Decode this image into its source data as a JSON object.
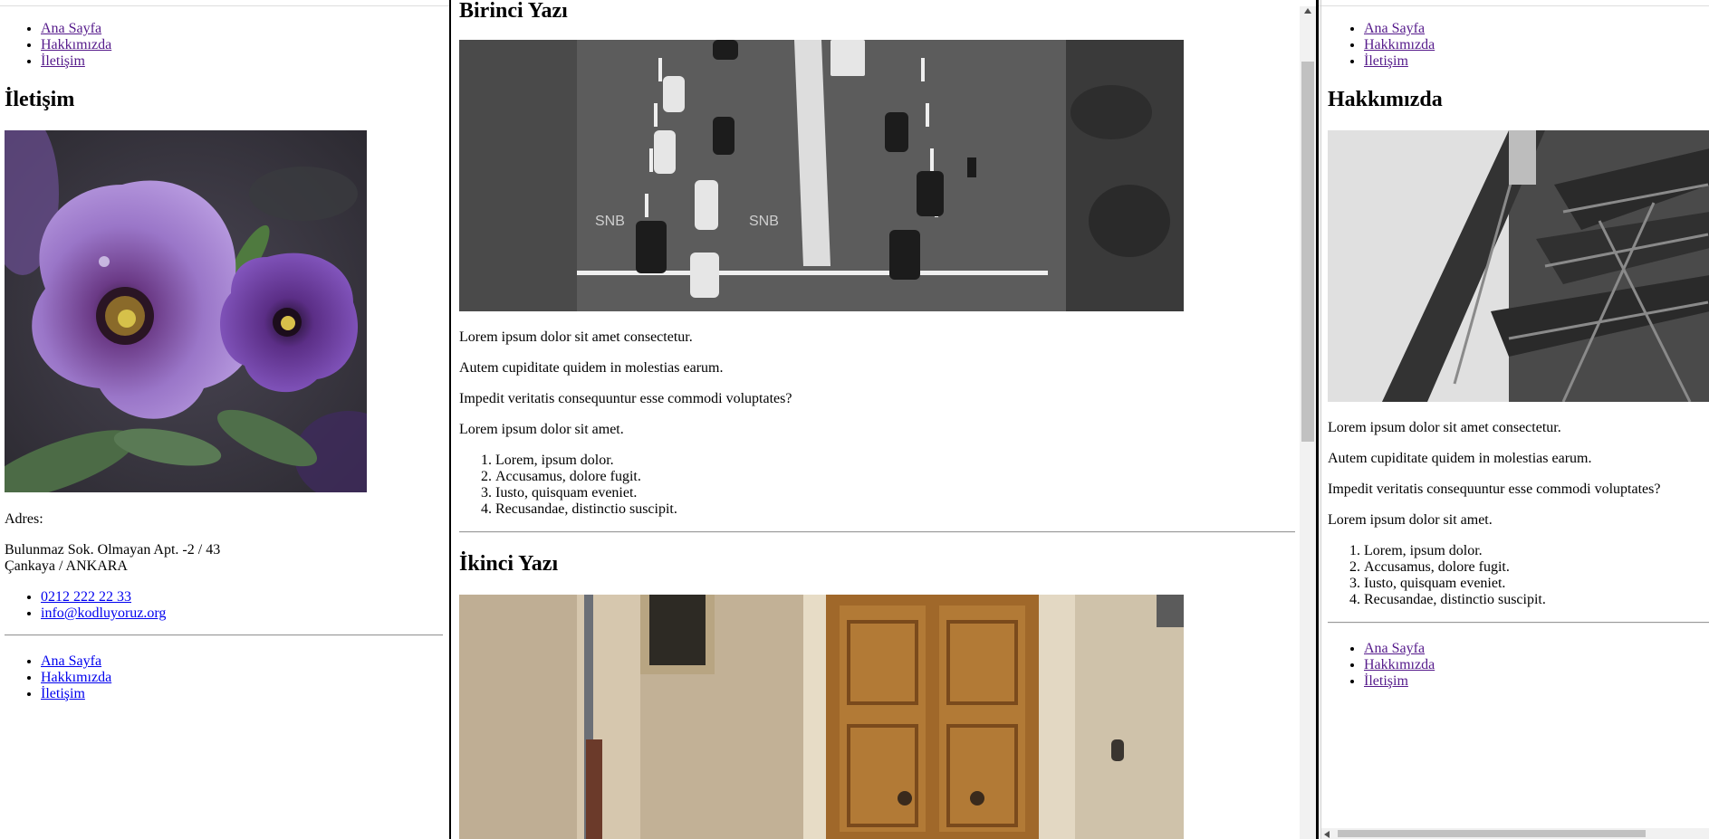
{
  "nav": {
    "home": "Ana Sayfa",
    "about": "Hakkımızda",
    "contact": "İletişim"
  },
  "left": {
    "title": "İletişim",
    "image_alt": "purple-petunia-flowers-photo",
    "address_label": "Adres:",
    "address_line1": "Bulunmaz Sok. Olmayan Apt. -2 / 43",
    "address_line2": "Çankaya / ANKARA",
    "phone": "0212 222 22 33",
    "email": "info@kodluyoruz.org"
  },
  "center": {
    "post1_title": "Birinci Yazı",
    "post1_image": "black-and-white-street-traffic-photo",
    "post2_title": "İkinci Yazı",
    "post2_image": "wooden-door-old-wall-photo"
  },
  "right": {
    "title": "Hakkımızda",
    "image_alt": "black-and-white-steel-tower-photo"
  },
  "content": {
    "p1": "Lorem ipsum dolor sit amet consectetur.",
    "p2": "Autem cupiditate quidem in molestias earum.",
    "p3": "Impedit veritatis consequuntur esse commodi voluptates?",
    "p4": "Lorem ipsum dolor sit amet.",
    "list": [
      "Lorem, ipsum dolor.",
      "Accusamus, dolore fugit.",
      "Iusto, quisquam eveniet.",
      "Recusandae, distinctio suscipit."
    ]
  }
}
